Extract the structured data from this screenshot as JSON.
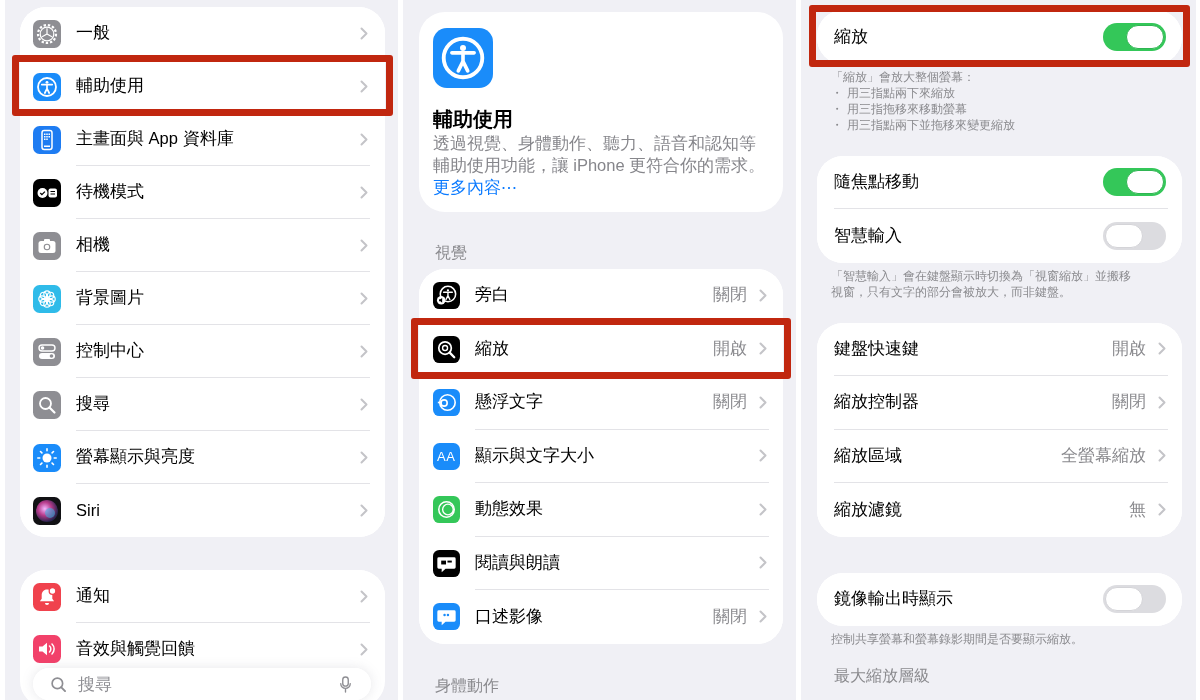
{
  "settings": {
    "groups": [
      {
        "items": [
          {
            "label": "一般",
            "kind": "link",
            "highlighted": false
          },
          {
            "label": "輔助使用",
            "kind": "link",
            "highlighted": true
          },
          {
            "label": "主畫面與 App 資料庫",
            "kind": "link",
            "highlighted": false
          },
          {
            "label": "待機模式",
            "kind": "link",
            "highlighted": false
          },
          {
            "label": "相機",
            "kind": "link",
            "highlighted": false
          },
          {
            "label": "背景圖片",
            "kind": "link",
            "highlighted": false
          },
          {
            "label": "控制中心",
            "kind": "link",
            "highlighted": false
          },
          {
            "label": "搜尋",
            "kind": "link",
            "highlighted": false
          },
          {
            "label": "螢幕顯示與亮度",
            "kind": "link",
            "highlighted": false
          },
          {
            "label": "Siri",
            "kind": "link",
            "highlighted": false
          }
        ]
      },
      {
        "items": [
          {
            "label": "通知",
            "kind": "link",
            "highlighted": false
          },
          {
            "label": "音效與觸覺回饋",
            "kind": "link",
            "highlighted": false
          }
        ]
      }
    ],
    "search": {
      "placeholder": "搜尋"
    }
  },
  "accessibility": {
    "header": {
      "title": "輔助使用",
      "description": [
        "透過視覺、身體動作、聽力、語音和認知等",
        "輔助使用功能，讓 iPhone 更符合你的需求。"
      ],
      "link": "更多內容⋯"
    },
    "sections": [
      {
        "title": "視覺",
        "items": [
          {
            "label": "旁白",
            "kind": "link",
            "value": "關閉",
            "highlighted": false
          },
          {
            "label": "縮放",
            "kind": "link",
            "value": "開啟",
            "highlighted": true
          },
          {
            "label": "懸浮文字",
            "kind": "link",
            "value": "關閉",
            "highlighted": false
          },
          {
            "label": "顯示與文字大小",
            "kind": "link",
            "icon_text": "AA",
            "highlighted": false
          },
          {
            "label": "動態效果",
            "kind": "link",
            "highlighted": false
          },
          {
            "label": "閱讀與朗讀",
            "kind": "link",
            "highlighted": false
          },
          {
            "label": "口述影像",
            "kind": "link",
            "value": "關閉",
            "highlighted": false
          }
        ]
      },
      {
        "title": "身體動作"
      }
    ]
  },
  "zoom": {
    "groups": [
      {
        "items": [
          {
            "label": "縮放",
            "kind": "toggle",
            "on": true,
            "highlighted": true
          }
        ],
        "footer": [
          "「縮放」會放大整個螢幕：",
          "・ 用三指點兩下來縮放",
          "・ 用三指拖移來移動螢幕",
          "・ 用三指點兩下並拖移來變更縮放"
        ]
      },
      {
        "items": [
          {
            "label": "隨焦點移動",
            "kind": "toggle",
            "on": true,
            "highlighted": false
          },
          {
            "label": "智慧輸入",
            "kind": "toggle",
            "on": false,
            "highlighted": false
          }
        ],
        "footer": [
          "「智慧輸入」會在鍵盤顯示時切換為「視窗縮放」並搬移",
          "視窗，只有文字的部分會被放大，而非鍵盤。"
        ]
      },
      {
        "items": [
          {
            "label": "鍵盤快速鍵",
            "kind": "link",
            "value": "開啟",
            "highlighted": false
          },
          {
            "label": "縮放控制器",
            "kind": "link",
            "value": "關閉",
            "highlighted": false
          },
          {
            "label": "縮放區域",
            "kind": "link",
            "value": "全螢幕縮放",
            "highlighted": false
          },
          {
            "label": "縮放濾鏡",
            "kind": "link",
            "value": "無",
            "highlighted": false
          }
        ]
      },
      {
        "items": [
          {
            "label": "鏡像輸出時顯示",
            "kind": "toggle",
            "on": false,
            "highlighted": false
          }
        ],
        "footer": [
          "控制共享螢幕和螢幕錄影期間是否要顯示縮放。"
        ]
      }
    ],
    "section_title": "最大縮放層級"
  }
}
